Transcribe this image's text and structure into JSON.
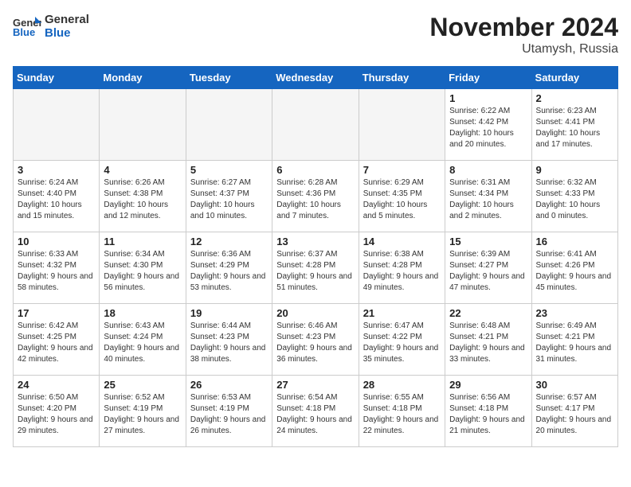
{
  "logo": {
    "line1": "General",
    "line2": "Blue"
  },
  "title": "November 2024",
  "location": "Utamysh, Russia",
  "days_of_week": [
    "Sunday",
    "Monday",
    "Tuesday",
    "Wednesday",
    "Thursday",
    "Friday",
    "Saturday"
  ],
  "weeks": [
    [
      {
        "day": "",
        "info": ""
      },
      {
        "day": "",
        "info": ""
      },
      {
        "day": "",
        "info": ""
      },
      {
        "day": "",
        "info": ""
      },
      {
        "day": "",
        "info": ""
      },
      {
        "day": "1",
        "info": "Sunrise: 6:22 AM\nSunset: 4:42 PM\nDaylight: 10 hours and 20 minutes."
      },
      {
        "day": "2",
        "info": "Sunrise: 6:23 AM\nSunset: 4:41 PM\nDaylight: 10 hours and 17 minutes."
      }
    ],
    [
      {
        "day": "3",
        "info": "Sunrise: 6:24 AM\nSunset: 4:40 PM\nDaylight: 10 hours and 15 minutes."
      },
      {
        "day": "4",
        "info": "Sunrise: 6:26 AM\nSunset: 4:38 PM\nDaylight: 10 hours and 12 minutes."
      },
      {
        "day": "5",
        "info": "Sunrise: 6:27 AM\nSunset: 4:37 PM\nDaylight: 10 hours and 10 minutes."
      },
      {
        "day": "6",
        "info": "Sunrise: 6:28 AM\nSunset: 4:36 PM\nDaylight: 10 hours and 7 minutes."
      },
      {
        "day": "7",
        "info": "Sunrise: 6:29 AM\nSunset: 4:35 PM\nDaylight: 10 hours and 5 minutes."
      },
      {
        "day": "8",
        "info": "Sunrise: 6:31 AM\nSunset: 4:34 PM\nDaylight: 10 hours and 2 minutes."
      },
      {
        "day": "9",
        "info": "Sunrise: 6:32 AM\nSunset: 4:33 PM\nDaylight: 10 hours and 0 minutes."
      }
    ],
    [
      {
        "day": "10",
        "info": "Sunrise: 6:33 AM\nSunset: 4:32 PM\nDaylight: 9 hours and 58 minutes."
      },
      {
        "day": "11",
        "info": "Sunrise: 6:34 AM\nSunset: 4:30 PM\nDaylight: 9 hours and 56 minutes."
      },
      {
        "day": "12",
        "info": "Sunrise: 6:36 AM\nSunset: 4:29 PM\nDaylight: 9 hours and 53 minutes."
      },
      {
        "day": "13",
        "info": "Sunrise: 6:37 AM\nSunset: 4:28 PM\nDaylight: 9 hours and 51 minutes."
      },
      {
        "day": "14",
        "info": "Sunrise: 6:38 AM\nSunset: 4:28 PM\nDaylight: 9 hours and 49 minutes."
      },
      {
        "day": "15",
        "info": "Sunrise: 6:39 AM\nSunset: 4:27 PM\nDaylight: 9 hours and 47 minutes."
      },
      {
        "day": "16",
        "info": "Sunrise: 6:41 AM\nSunset: 4:26 PM\nDaylight: 9 hours and 45 minutes."
      }
    ],
    [
      {
        "day": "17",
        "info": "Sunrise: 6:42 AM\nSunset: 4:25 PM\nDaylight: 9 hours and 42 minutes."
      },
      {
        "day": "18",
        "info": "Sunrise: 6:43 AM\nSunset: 4:24 PM\nDaylight: 9 hours and 40 minutes."
      },
      {
        "day": "19",
        "info": "Sunrise: 6:44 AM\nSunset: 4:23 PM\nDaylight: 9 hours and 38 minutes."
      },
      {
        "day": "20",
        "info": "Sunrise: 6:46 AM\nSunset: 4:23 PM\nDaylight: 9 hours and 36 minutes."
      },
      {
        "day": "21",
        "info": "Sunrise: 6:47 AM\nSunset: 4:22 PM\nDaylight: 9 hours and 35 minutes."
      },
      {
        "day": "22",
        "info": "Sunrise: 6:48 AM\nSunset: 4:21 PM\nDaylight: 9 hours and 33 minutes."
      },
      {
        "day": "23",
        "info": "Sunrise: 6:49 AM\nSunset: 4:21 PM\nDaylight: 9 hours and 31 minutes."
      }
    ],
    [
      {
        "day": "24",
        "info": "Sunrise: 6:50 AM\nSunset: 4:20 PM\nDaylight: 9 hours and 29 minutes."
      },
      {
        "day": "25",
        "info": "Sunrise: 6:52 AM\nSunset: 4:19 PM\nDaylight: 9 hours and 27 minutes."
      },
      {
        "day": "26",
        "info": "Sunrise: 6:53 AM\nSunset: 4:19 PM\nDaylight: 9 hours and 26 minutes."
      },
      {
        "day": "27",
        "info": "Sunrise: 6:54 AM\nSunset: 4:18 PM\nDaylight: 9 hours and 24 minutes."
      },
      {
        "day": "28",
        "info": "Sunrise: 6:55 AM\nSunset: 4:18 PM\nDaylight: 9 hours and 22 minutes."
      },
      {
        "day": "29",
        "info": "Sunrise: 6:56 AM\nSunset: 4:18 PM\nDaylight: 9 hours and 21 minutes."
      },
      {
        "day": "30",
        "info": "Sunrise: 6:57 AM\nSunset: 4:17 PM\nDaylight: 9 hours and 20 minutes."
      }
    ]
  ]
}
